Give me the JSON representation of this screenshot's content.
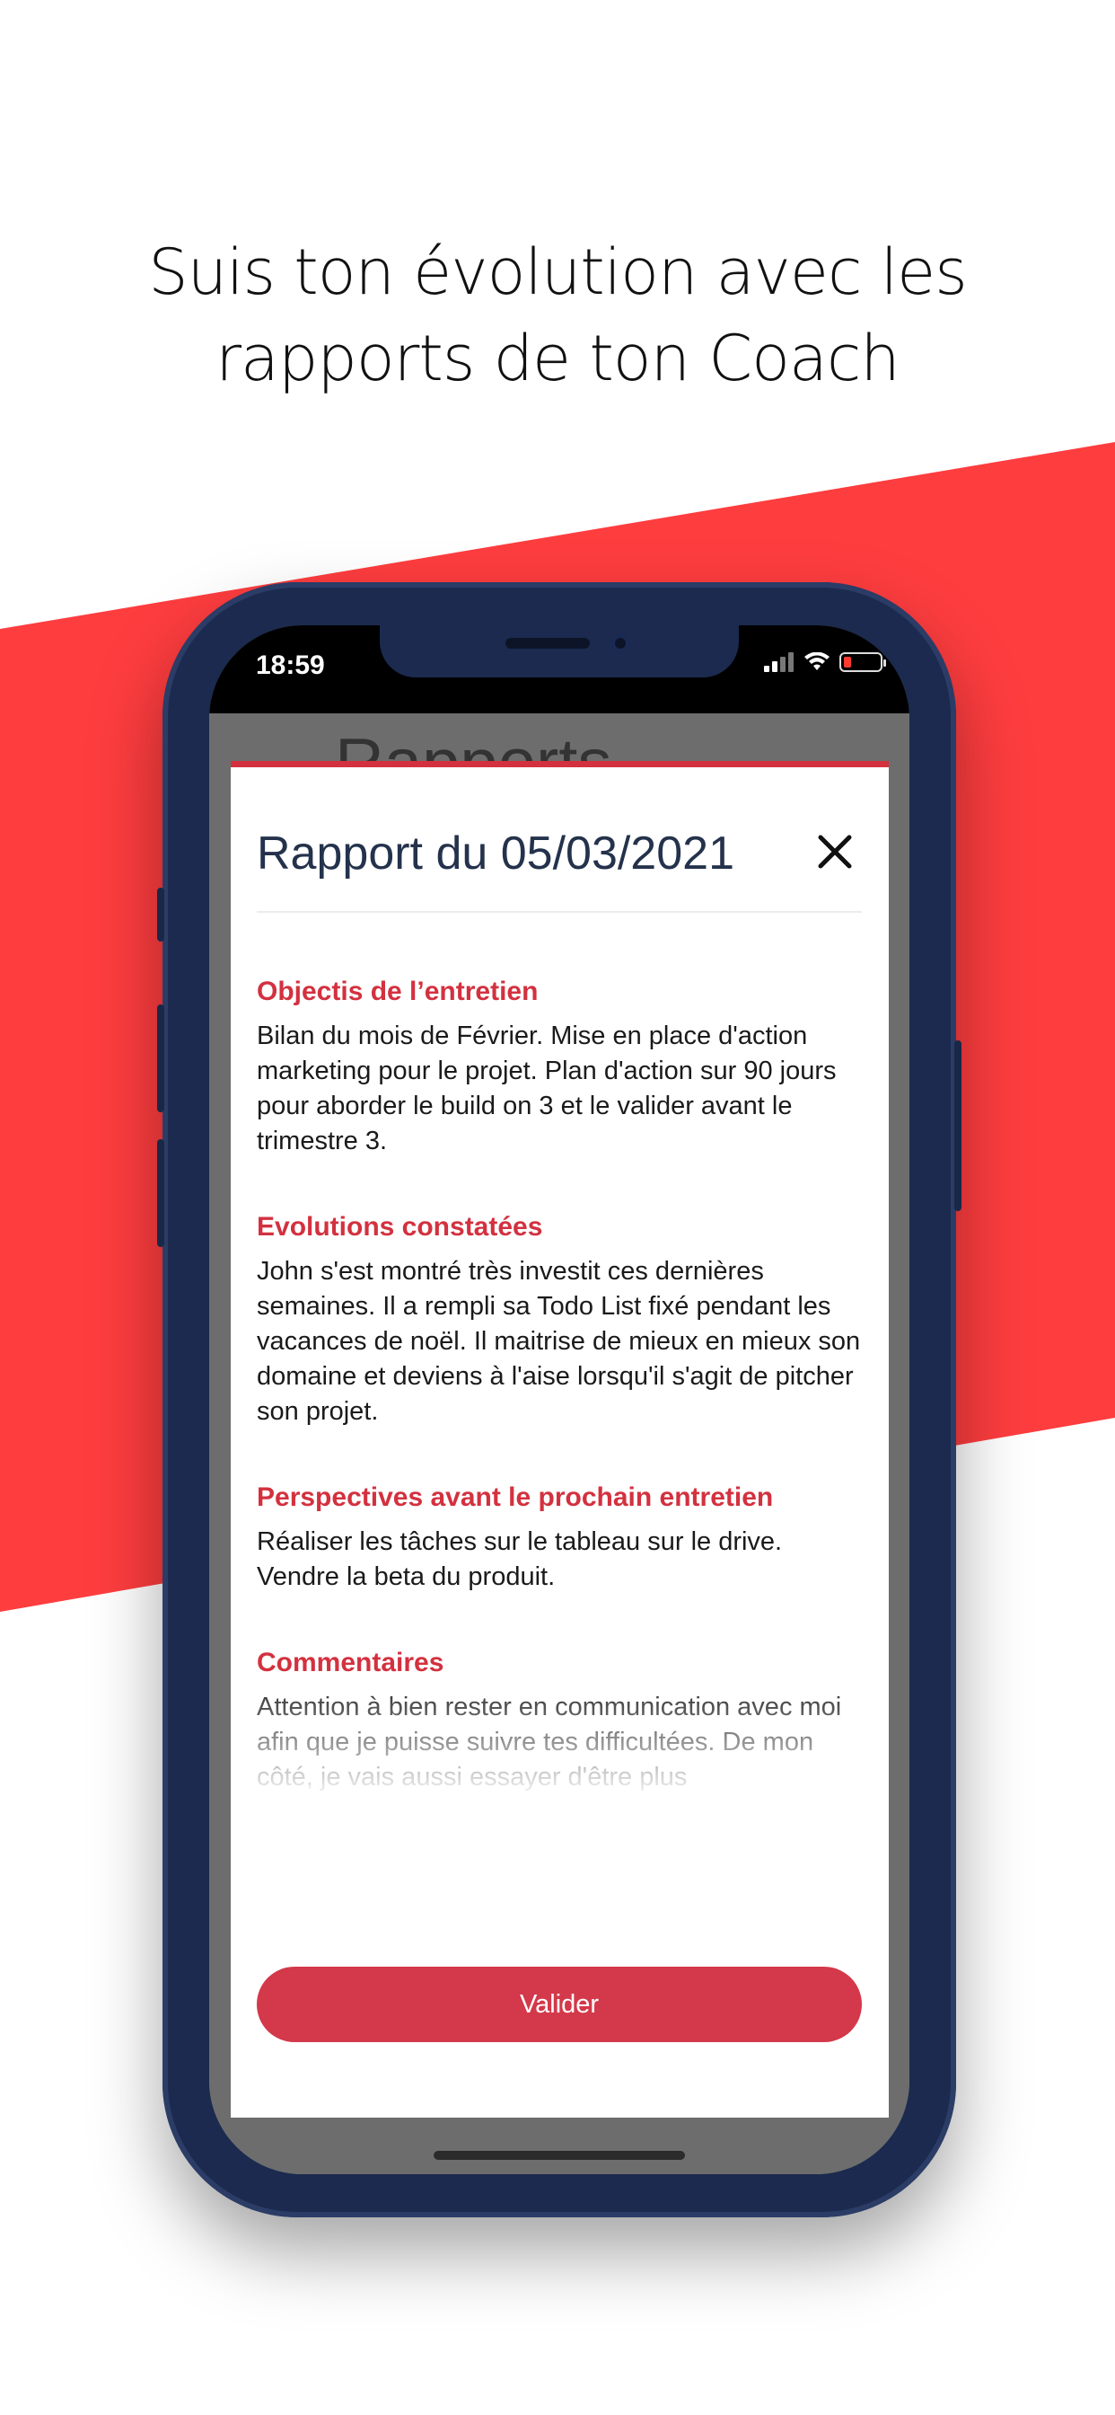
{
  "marketing": {
    "headline_line1": "Suis ton évolution avec les",
    "headline_line2": "rapports de ton Coach"
  },
  "colors": {
    "accent": "#d3313f",
    "band": "#fe3d3f",
    "phone": "#1b2a4e"
  },
  "status_bar": {
    "time": "18:59",
    "icons": [
      "signal-icon",
      "wifi-icon",
      "battery-low-icon"
    ]
  },
  "app": {
    "title": "Rapports",
    "menu_icon": "hamburger-icon"
  },
  "modal": {
    "title": "Rapport du  05/03/2021",
    "close_icon": "close-icon",
    "sections": [
      {
        "title": "Objectis de l’entretien",
        "text": "Bilan du mois de Février. Mise en place d'action marketing pour le projet. Plan d'action sur 90 jours pour aborder le build on 3 et le valider avant le trimestre 3."
      },
      {
        "title": "Evolutions constatées",
        "text": "John s'est montré très investit ces dernières semaines. Il a rempli sa Todo List fixé pendant les vacances de noël. Il maitrise de mieux en mieux son domaine et deviens à l'aise lorsqu'il s'agit de pitcher son projet."
      },
      {
        "title": "Perspectives avant le prochain entretien",
        "text": "Réaliser les tâches sur le tableau sur le drive. Vendre la beta du produit."
      },
      {
        "title": "Commentaires",
        "text": "Attention à bien rester en communication avec moi afin que je puisse suivre tes difficultées. De mon côté, je vais aussi essayer d'être plus"
      }
    ],
    "validate_label": "Valider"
  }
}
